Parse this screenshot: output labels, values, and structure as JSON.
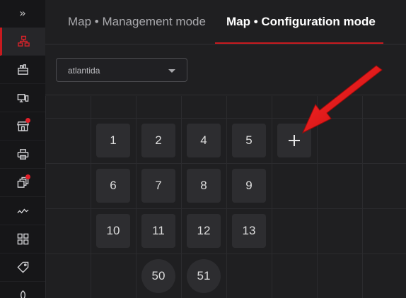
{
  "sidebar": {
    "collapse_glyph": "»",
    "items": [
      {
        "icon": "sitemap-icon",
        "active": true,
        "badge": false
      },
      {
        "icon": "building-icon",
        "active": false,
        "badge": false
      },
      {
        "icon": "devices-icon",
        "active": false,
        "badge": false
      },
      {
        "icon": "store-icon",
        "active": false,
        "badge": true
      },
      {
        "icon": "printer-icon",
        "active": false,
        "badge": false
      },
      {
        "icon": "layers-icon",
        "active": false,
        "badge": true
      },
      {
        "icon": "activity-icon",
        "active": false,
        "badge": false
      },
      {
        "icon": "grid-icon",
        "active": false,
        "badge": false
      },
      {
        "icon": "tag-icon",
        "active": false,
        "badge": false
      },
      {
        "icon": "leaf-icon",
        "active": false,
        "badge": false
      }
    ],
    "badge_color": "#e2202a",
    "accent_color": "#c81a1f"
  },
  "tabs": [
    {
      "label": "Map • Management mode",
      "active": false
    },
    {
      "label": "Map • Configuration mode",
      "active": true
    }
  ],
  "filter": {
    "location_select": {
      "value": "atlantida"
    }
  },
  "grid": {
    "rows": [
      [
        "1",
        "2",
        "4",
        "5"
      ],
      [
        "6",
        "7",
        "8",
        "9"
      ],
      [
        "10",
        "11",
        "12",
        "13"
      ],
      [
        "",
        "50",
        "51",
        ""
      ]
    ],
    "add_button_icon": "plus-icon"
  },
  "annotation": {
    "arrow_color": "#e01b1b",
    "points_to": "add-table-button"
  }
}
